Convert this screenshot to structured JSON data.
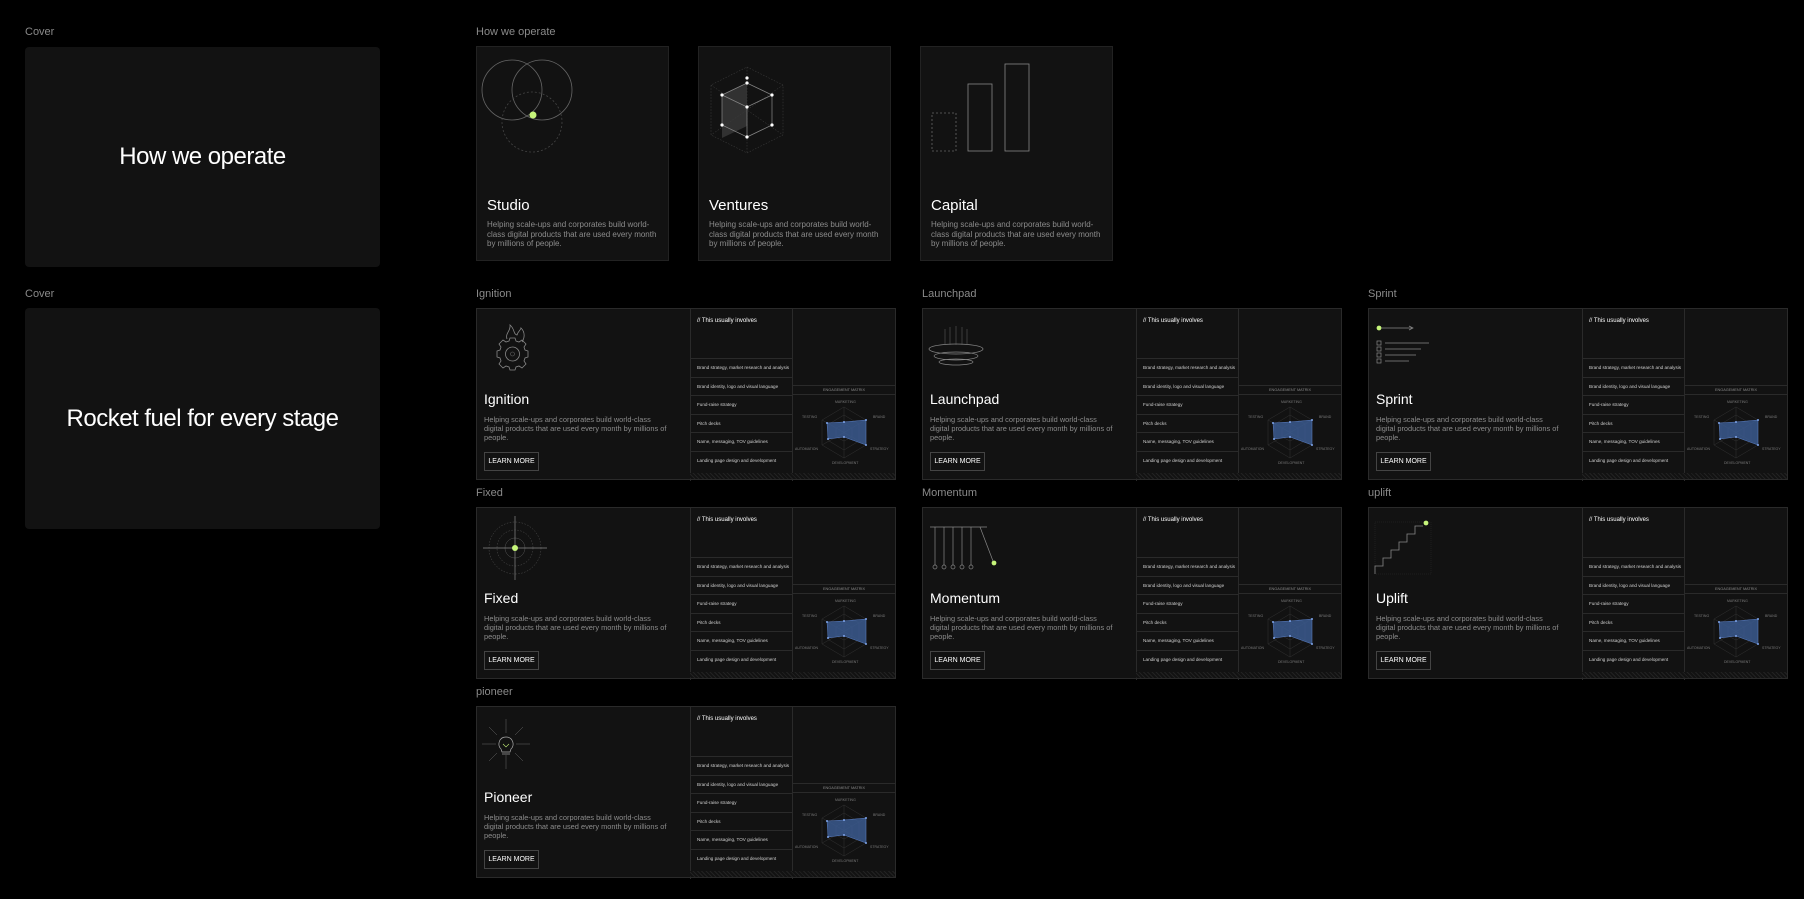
{
  "frames": {
    "cover1_label": "Cover",
    "cover2_label": "Cover",
    "operate_label": "How we operate",
    "ignition_label": "Ignition",
    "launchpad_label": "Launchpad",
    "sprint_label": "Sprint",
    "fixed_label": "Fixed",
    "momentum_label": "Momentum",
    "uplift_label": "uplift",
    "pioneer_label": "pioneer"
  },
  "covers": {
    "cover1_title": "How we operate",
    "cover2_title": "Rocket fuel for every stage"
  },
  "operate": {
    "cards": [
      {
        "title": "Studio",
        "desc": "Helping scale-ups and corporates build world-class digital products that are used every month by millions of people."
      },
      {
        "title": "Ventures",
        "desc": "Helping scale-ups and corporates build world-class digital products that are used every month by millions of people."
      },
      {
        "title": "Capital",
        "desc": "Helping scale-ups and corporates build world-class digital products that are used every month by millions of people."
      }
    ]
  },
  "products": {
    "common": {
      "list_heading": "// This usually involves",
      "items": [
        "Brand strategy, market research and analysis",
        "Brand identity, logo and visual language",
        "Fund-raise strategy",
        "Pitch decks",
        "Name, messaging, TOV guidelines",
        "Landing page design and development"
      ],
      "matrix_title": "ENGAGEMENT MATRIX",
      "axes": {
        "top": "MARKETING",
        "right_top": "BRAND",
        "right_bottom": "STRATEGY",
        "bottom": "DEVELOPMENT",
        "left_bottom": "AUTOMATION",
        "left_top": "TESTING"
      },
      "button": "LEARN MORE",
      "desc": "Helping scale-ups and corporates build world-class digital products that are used every month by millions of people."
    },
    "cards": [
      {
        "title": "Ignition"
      },
      {
        "title": "Launchpad"
      },
      {
        "title": "Sprint"
      },
      {
        "title": "Fixed"
      },
      {
        "title": "Momentum"
      },
      {
        "title": "Uplift"
      },
      {
        "title": "Pioneer"
      }
    ]
  },
  "colors": {
    "accent": "#c6f57a",
    "radar_fill": "#3b5a8f",
    "card_bg": "#121212",
    "page_bg": "#000000"
  }
}
